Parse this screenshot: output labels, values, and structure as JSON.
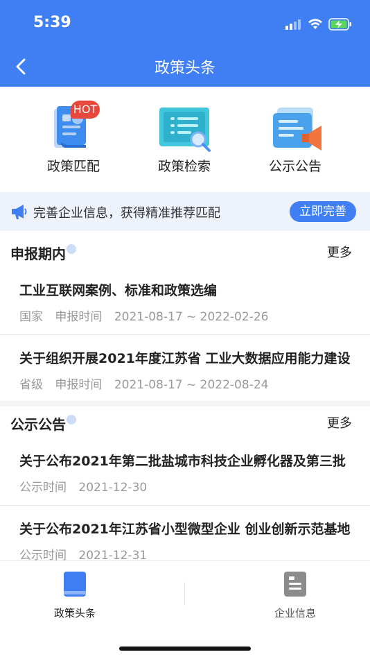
{
  "status_bar": {
    "time": "5:39"
  },
  "nav": {
    "title": "政策头条"
  },
  "quick_links": [
    {
      "label": "政策匹配",
      "badge": "HOT"
    },
    {
      "label": "政策检索"
    },
    {
      "label": "公示公告"
    }
  ],
  "banner": {
    "text": "完善企业信息，获得精准推荐匹配",
    "button": "立即完善"
  },
  "section1": {
    "title": "申报期内",
    "more": "更多",
    "items": [
      {
        "title": "工业互联网案例、标准和政策选编",
        "level": "国家",
        "label": "申报时间",
        "range": "2021-08-17 ~ 2022-02-26"
      },
      {
        "title": "关于组织开展2021年度江苏省 工业大数据应用能力建设",
        "level": "省级",
        "label": "申报时间",
        "range": "2021-08-17 ~ 2022-08-24"
      }
    ]
  },
  "section2": {
    "title": "公示公告",
    "more": "更多",
    "items": [
      {
        "title": "关于公布2021年第二批盐城市科技企业孵化器及第三批",
        "label": "公示时间",
        "date": "2021-12-30"
      },
      {
        "title": "关于公布2021年江苏省小型微型企业 创业创新示范基地",
        "label": "公示时间",
        "date": "2021-12-31"
      }
    ]
  },
  "tabbar": {
    "tabs": [
      {
        "label": "政策头条"
      },
      {
        "label": "企业信息"
      }
    ]
  },
  "colors": {
    "primary": "#3f7ff3",
    "hot": "#e8483b"
  }
}
